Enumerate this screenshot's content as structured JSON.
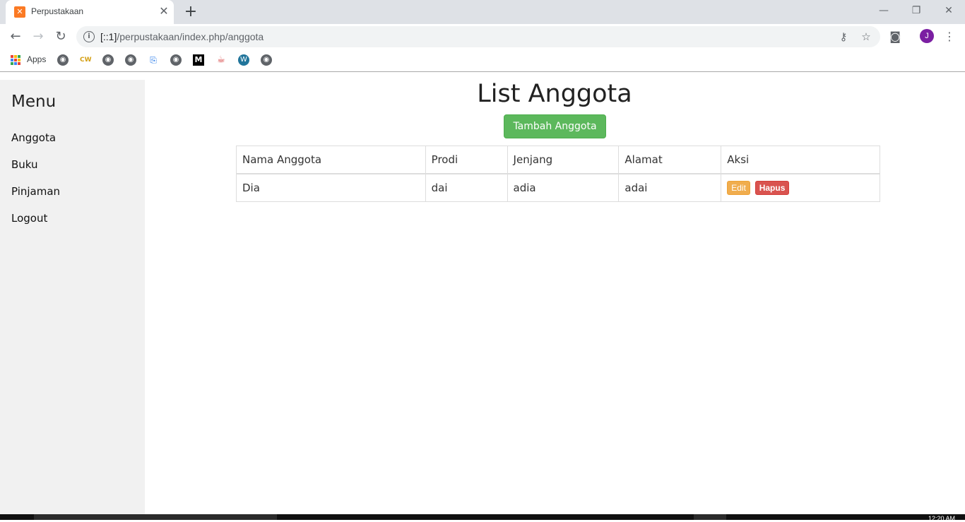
{
  "browser": {
    "tab_title": "Perpustakaan",
    "tab_favicon": "xampp-icon",
    "url_prefix": "[::1]",
    "url_path": "/perpustakaan/index.php/anggota",
    "avatar_letter": "J",
    "apps_label": "Apps",
    "bookmark_cw": "CW",
    "bookmark_m": "M"
  },
  "sidebar": {
    "title": "Menu",
    "items": [
      {
        "label": "Anggota"
      },
      {
        "label": "Buku"
      },
      {
        "label": "Pinjaman"
      },
      {
        "label": "Logout"
      }
    ]
  },
  "main": {
    "title": "List Anggota",
    "add_button": "Tambah Anggota",
    "table": {
      "headers": [
        "Nama Anggota",
        "Prodi",
        "Jenjang",
        "Alamat",
        "Aksi"
      ],
      "rows": [
        {
          "nama": "Dia",
          "prodi": "dai",
          "jenjang": "adia",
          "alamat": "adai",
          "edit": "Edit",
          "hapus": "Hapus"
        }
      ]
    }
  },
  "taskbar": {
    "time": "12:20 AM"
  },
  "colors": {
    "primary_success": "#5cb85c",
    "warning": "#f0ad4e",
    "danger": "#d9534f",
    "avatar": "#7b1fa2"
  }
}
